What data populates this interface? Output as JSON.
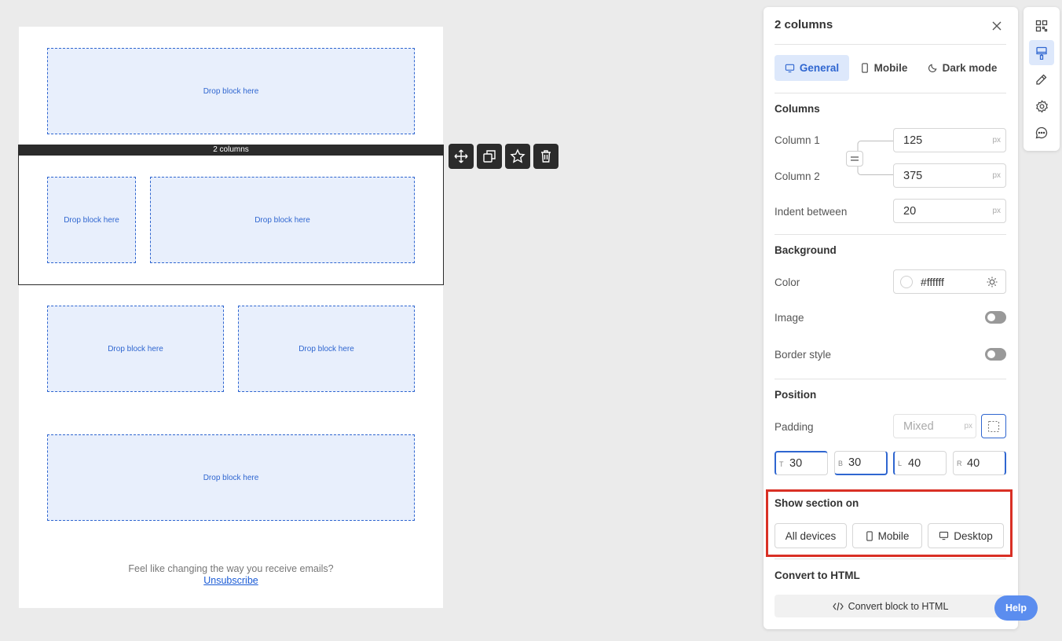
{
  "canvas": {
    "drop_label": "Drop block here",
    "selected_label": "2 columns",
    "footer_text": "Feel like changing the way you receive emails?",
    "footer_link": "Unsubscribe"
  },
  "panel": {
    "title": "2 columns",
    "tabs": [
      {
        "label": "General",
        "icon": "desktop-icon"
      },
      {
        "label": "Mobile",
        "icon": "mobile-icon"
      },
      {
        "label": "Dark mode",
        "icon": "moon-icon"
      }
    ],
    "columns": {
      "title": "Columns",
      "col1_label": "Column 1",
      "col1_value": "125",
      "col2_label": "Column 2",
      "col2_value": "375",
      "indent_label": "Indent between",
      "indent_value": "20",
      "unit": "px"
    },
    "background": {
      "title": "Background",
      "color_label": "Color",
      "color_value": "#ffffff",
      "image_label": "Image",
      "border_label": "Border style"
    },
    "position": {
      "title": "Position",
      "padding_label": "Padding",
      "padding_value": "Mixed",
      "unit": "px",
      "t_key": "T",
      "t": "30",
      "b_key": "B",
      "b": "30",
      "l_key": "L",
      "l": "40",
      "r_key": "R",
      "r": "40"
    },
    "show_section": {
      "title": "Show section on",
      "all": "All devices",
      "mobile": "Mobile",
      "desktop": "Desktop"
    },
    "convert": {
      "title": "Convert to HTML",
      "button": "Convert block to HTML"
    }
  },
  "help": "Help",
  "colors": {
    "accent": "#2f66d0",
    "highlight": "#d93025",
    "dark": "#2b2b2b"
  }
}
